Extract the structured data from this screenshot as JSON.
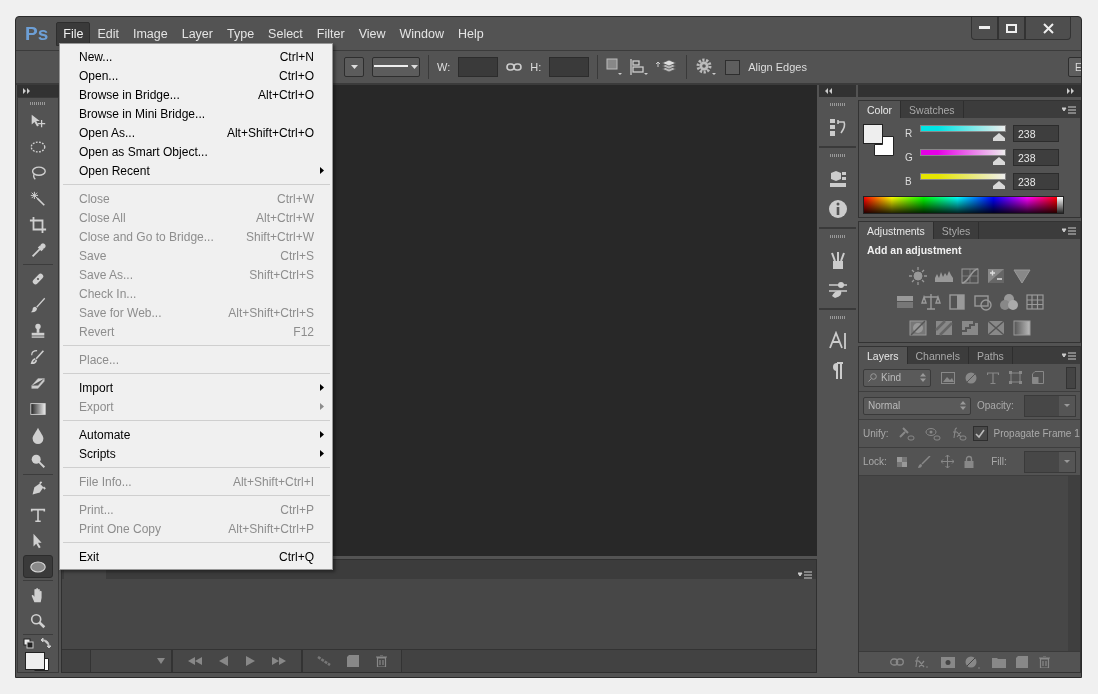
{
  "window": {
    "logo": "Ps"
  },
  "menubar": [
    {
      "label": "File",
      "selected": true
    },
    {
      "label": "Edit",
      "selected": false
    },
    {
      "label": "Image",
      "selected": false
    },
    {
      "label": "Layer",
      "selected": false
    },
    {
      "label": "Type",
      "selected": false
    },
    {
      "label": "Select",
      "selected": false
    },
    {
      "label": "Filter",
      "selected": false
    },
    {
      "label": "View",
      "selected": false
    },
    {
      "label": "Window",
      "selected": false
    },
    {
      "label": "Help",
      "selected": false
    }
  ],
  "file_menu": [
    {
      "kind": "item",
      "label": "New...",
      "shortcut": "Ctrl+N",
      "disabled": false,
      "submenu": false
    },
    {
      "kind": "item",
      "label": "Open...",
      "shortcut": "Ctrl+O",
      "disabled": false,
      "submenu": false
    },
    {
      "kind": "item",
      "label": "Browse in Bridge...",
      "shortcut": "Alt+Ctrl+O",
      "disabled": false,
      "submenu": false
    },
    {
      "kind": "item",
      "label": "Browse in Mini Bridge...",
      "disabled": false,
      "submenu": false
    },
    {
      "kind": "item",
      "label": "Open As...",
      "shortcut": "Alt+Shift+Ctrl+O",
      "disabled": false,
      "submenu": false
    },
    {
      "kind": "item",
      "label": "Open as Smart Object...",
      "disabled": false,
      "submenu": false
    },
    {
      "kind": "item",
      "label": "Open Recent",
      "disabled": false,
      "submenu": true
    },
    {
      "kind": "separator"
    },
    {
      "kind": "item",
      "label": "Close",
      "shortcut": "Ctrl+W",
      "disabled": true,
      "submenu": false
    },
    {
      "kind": "item",
      "label": "Close All",
      "shortcut": "Alt+Ctrl+W",
      "disabled": true,
      "submenu": false
    },
    {
      "kind": "item",
      "label": "Close and Go to Bridge...",
      "shortcut": "Shift+Ctrl+W",
      "disabled": true,
      "submenu": false
    },
    {
      "kind": "item",
      "label": "Save",
      "shortcut": "Ctrl+S",
      "disabled": true,
      "submenu": false
    },
    {
      "kind": "item",
      "label": "Save As...",
      "shortcut": "Shift+Ctrl+S",
      "disabled": true,
      "submenu": false
    },
    {
      "kind": "item",
      "label": "Check In...",
      "disabled": true,
      "submenu": false
    },
    {
      "kind": "item",
      "label": "Save for Web...",
      "shortcut": "Alt+Shift+Ctrl+S",
      "disabled": true,
      "submenu": false
    },
    {
      "kind": "item",
      "label": "Revert",
      "shortcut": "F12",
      "disabled": true,
      "submenu": false
    },
    {
      "kind": "separator"
    },
    {
      "kind": "item",
      "label": "Place...",
      "disabled": true,
      "submenu": false
    },
    {
      "kind": "separator"
    },
    {
      "kind": "item",
      "label": "Import",
      "disabled": false,
      "submenu": true
    },
    {
      "kind": "item",
      "label": "Export",
      "disabled": true,
      "submenu": true
    },
    {
      "kind": "separator"
    },
    {
      "kind": "item",
      "label": "Automate",
      "disabled": false,
      "submenu": true
    },
    {
      "kind": "item",
      "label": "Scripts",
      "disabled": false,
      "submenu": true
    },
    {
      "kind": "separator"
    },
    {
      "kind": "item",
      "label": "File Info...",
      "shortcut": "Alt+Shift+Ctrl+I",
      "disabled": true,
      "submenu": false
    },
    {
      "kind": "separator"
    },
    {
      "kind": "item",
      "label": "Print...",
      "shortcut": "Ctrl+P",
      "disabled": true,
      "submenu": false
    },
    {
      "kind": "item",
      "label": "Print One Copy",
      "shortcut": "Alt+Shift+Ctrl+P",
      "disabled": true,
      "submenu": false
    },
    {
      "kind": "separator"
    },
    {
      "kind": "item",
      "label": "Exit",
      "shortcut": "Ctrl+Q",
      "disabled": false,
      "submenu": false
    }
  ],
  "options_bar": {
    "width_label": "W:",
    "height_label": "H:",
    "align_edges": {
      "label": "Align Edges",
      "checked": false
    },
    "cut_button": "E"
  },
  "tool_groups": [
    [
      {
        "kind": "move",
        "selected": false
      },
      {
        "kind": "marquee",
        "selected": false
      },
      {
        "kind": "lasso",
        "selected": false
      },
      {
        "kind": "wand",
        "selected": false
      },
      {
        "kind": "crop",
        "selected": false
      },
      {
        "kind": "eyedropper",
        "selected": false
      }
    ],
    [
      {
        "kind": "healing",
        "selected": false
      },
      {
        "kind": "brush",
        "selected": false
      },
      {
        "kind": "stamp",
        "selected": false
      },
      {
        "kind": "history",
        "selected": false
      },
      {
        "kind": "eraser",
        "selected": false
      },
      {
        "kind": "gradient",
        "selected": false
      },
      {
        "kind": "blur",
        "selected": false
      },
      {
        "kind": "dodge",
        "selected": false
      }
    ],
    [
      {
        "kind": "pen",
        "selected": false
      },
      {
        "kind": "type",
        "selected": false
      },
      {
        "kind": "path",
        "selected": false
      },
      {
        "kind": "ellipse",
        "selected": true
      }
    ],
    [
      {
        "kind": "hand",
        "selected": false
      },
      {
        "kind": "zoom",
        "selected": false
      }
    ]
  ],
  "color_panel": {
    "tabs": [
      {
        "label": "Color",
        "selected": true
      },
      {
        "label": "Swatches",
        "selected": false
      }
    ],
    "channels": [
      {
        "name": "R",
        "color": "#00e5e5",
        "level": 0.933,
        "value": "238"
      },
      {
        "name": "G",
        "color": "#e500e5",
        "level": 0.933,
        "value": "238"
      },
      {
        "name": "B",
        "color": "#e5e500",
        "level": 0.933,
        "value": "238"
      }
    ]
  },
  "adjustments_panel": {
    "tabs": [
      {
        "label": "Adjustments",
        "selected": true
      },
      {
        "label": "Styles",
        "selected": false
      }
    ],
    "heading": "Add an adjustment"
  },
  "layers_panel": {
    "tabs": [
      {
        "label": "Layers",
        "selected": true
      },
      {
        "label": "Channels",
        "selected": false
      },
      {
        "label": "Paths",
        "selected": false
      }
    ],
    "filter": "Kind",
    "blend_mode": "Normal",
    "opacity_label": "Opacity:",
    "unify_label": "Unify:",
    "propagate": {
      "label": "Propagate Frame 1",
      "checked": true
    },
    "lock_label": "Lock:",
    "fill_label": "Fill:"
  }
}
